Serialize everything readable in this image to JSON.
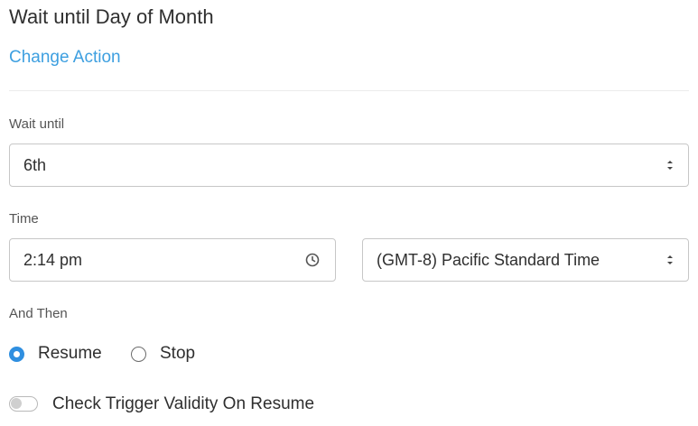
{
  "header": {
    "title": "Wait until Day of Month",
    "change_action_label": "Change Action"
  },
  "wait_until": {
    "label": "Wait until",
    "selected_value": "6th"
  },
  "time": {
    "label": "Time",
    "value": "2:14 pm",
    "timezone_selected": "(GMT-8) Pacific Standard Time"
  },
  "and_then": {
    "label": "And Then",
    "options": [
      {
        "label": "Resume",
        "selected": true
      },
      {
        "label": "Stop",
        "selected": false
      }
    ]
  },
  "trigger_validity": {
    "label": "Check Trigger Validity On Resume",
    "enabled": false
  },
  "icons": {
    "select_caret": "updown-caret-icon",
    "time": "clock-icon"
  },
  "colors": {
    "link": "#3d9fe0",
    "radio_selected": "#2f8fe0",
    "border": "#c7c7c7"
  }
}
